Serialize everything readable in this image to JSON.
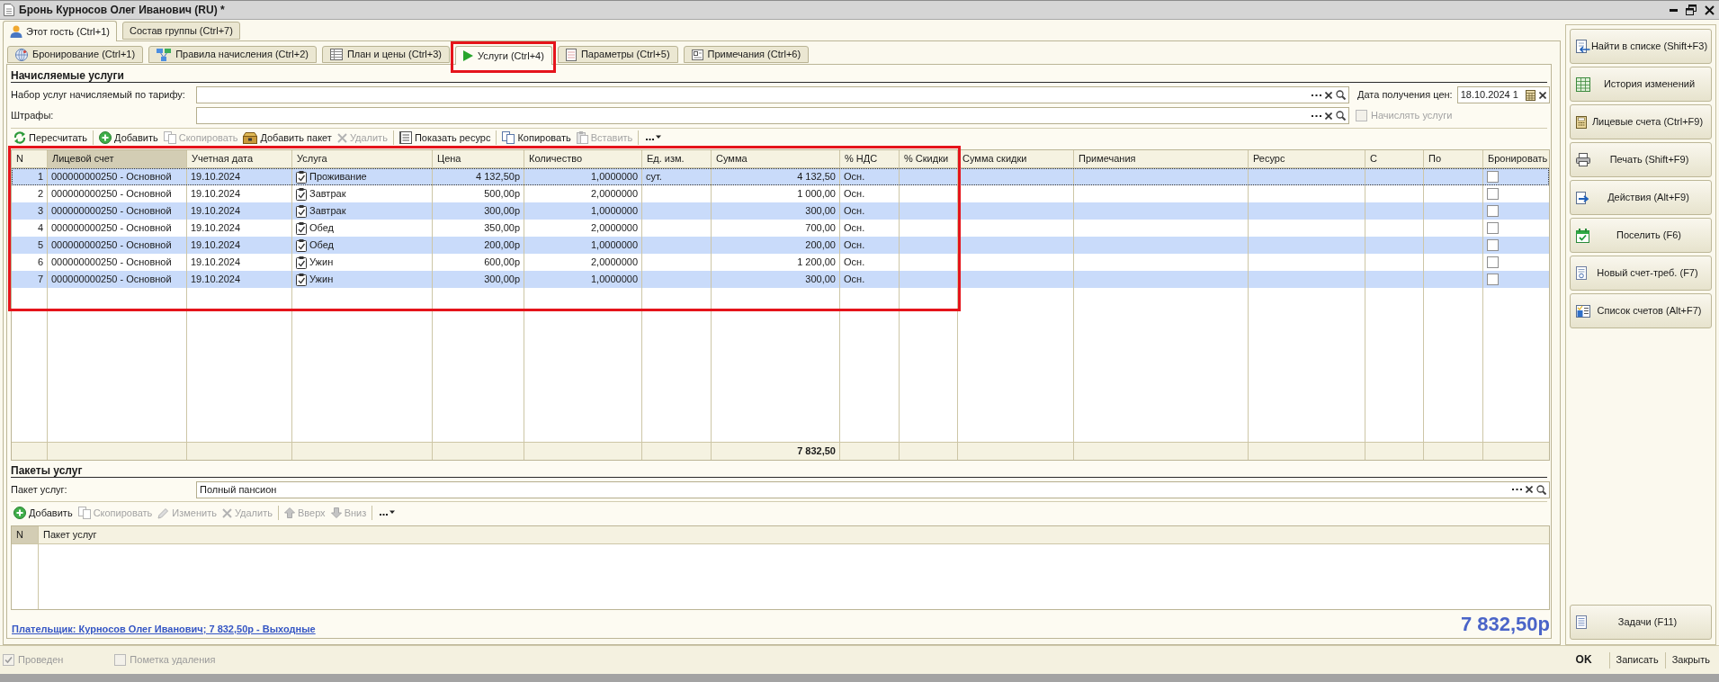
{
  "window": {
    "title": "Бронь Курносов Олег Иванович (RU) *"
  },
  "guest_tabs": [
    {
      "label": "Этот гость (Ctrl+1)",
      "selected": true
    },
    {
      "label": "Состав группы (Ctrl+7)",
      "selected": false
    }
  ],
  "section_tabs": [
    {
      "label": "Бронирование (Ctrl+1)",
      "selected": false,
      "highlighted": false
    },
    {
      "label": "Правила начисления (Ctrl+2)",
      "selected": false,
      "highlighted": false
    },
    {
      "label": "План и цены (Ctrl+3)",
      "selected": false,
      "highlighted": false
    },
    {
      "label": "Услуги (Ctrl+4)",
      "selected": true,
      "highlighted": true
    },
    {
      "label": "Параметры (Ctrl+5)",
      "selected": false,
      "highlighted": false
    },
    {
      "label": "Примечания (Ctrl+6)",
      "selected": false,
      "highlighted": false
    }
  ],
  "charged_services": {
    "title": "Начисляемые услуги",
    "tariff_set": {
      "label": "Набор услуг начисляемый по тарифу:"
    },
    "price_date": {
      "label": "Дата получения цен:",
      "value": "18.10.2024 1"
    },
    "penalties": {
      "label": "Штрафы:"
    },
    "charge_services": {
      "label": "Начислять услуги",
      "checked": false,
      "disabled": true
    },
    "toolbar": {
      "groups": [
        {
          "items": [
            {
              "label": "Пересчитать",
              "disabled": false
            }
          ]
        },
        {
          "items": [
            {
              "label": "Добавить",
              "disabled": false
            },
            {
              "label": "Скопировать",
              "disabled": true
            },
            {
              "label": "Добавить пакет",
              "disabled": false
            },
            {
              "label": "Удалить",
              "disabled": true
            }
          ]
        },
        {
          "items": [
            {
              "label": "Показать ресурс",
              "disabled": false
            }
          ]
        },
        {
          "items": [
            {
              "label": "Копировать",
              "disabled": false
            },
            {
              "label": "Вставить",
              "disabled": true
            }
          ]
        }
      ]
    },
    "table": {
      "highlighted": true,
      "columns": [
        {
          "label": "N",
          "current": false
        },
        {
          "label": "Лицевой счет",
          "current": true
        },
        {
          "label": "Учетная дата",
          "current": false
        },
        {
          "label": "Услуга",
          "current": false
        },
        {
          "label": "Цена",
          "current": false
        },
        {
          "label": "Количество",
          "current": false
        },
        {
          "label": "Ед. изм.",
          "current": false
        },
        {
          "label": "Сумма",
          "current": false
        },
        {
          "label": "% НДС",
          "current": false
        },
        {
          "label": "% Скидки",
          "current": false
        },
        {
          "label": "Сумма скидки",
          "current": false
        },
        {
          "label": "Примечания",
          "current": false
        },
        {
          "label": "Ресурс",
          "current": false
        },
        {
          "label": "С",
          "current": false
        },
        {
          "label": "По",
          "current": false
        },
        {
          "label": "Бронировать",
          "current": false
        }
      ],
      "rows": [
        {
          "n": "1",
          "account": "000000000250 - Основной",
          "date": "19.10.2024",
          "service": "Проживание",
          "price": "4 132,50р",
          "quantity": "1,0000000",
          "unit": "сут.",
          "sum": "4 132,50",
          "vat": "Осн.",
          "book": false,
          "current": true
        },
        {
          "n": "2",
          "account": "000000000250 - Основной",
          "date": "19.10.2024",
          "service": "Завтрак",
          "price": "500,00р",
          "quantity": "2,0000000",
          "sum": "1 000,00",
          "vat": "Осн.",
          "book": false,
          "current": false
        },
        {
          "n": "3",
          "account": "000000000250 - Основной",
          "date": "19.10.2024",
          "service": "Завтрак",
          "price": "300,00р",
          "quantity": "1,0000000",
          "sum": "300,00",
          "vat": "Осн.",
          "book": false,
          "current": false
        },
        {
          "n": "4",
          "account": "000000000250 - Основной",
          "date": "19.10.2024",
          "service": "Обед",
          "price": "350,00р",
          "quantity": "2,0000000",
          "sum": "700,00",
          "vat": "Осн.",
          "book": false,
          "current": false
        },
        {
          "n": "5",
          "account": "000000000250 - Основной",
          "date": "19.10.2024",
          "service": "Обед",
          "price": "200,00р",
          "quantity": "1,0000000",
          "sum": "200,00",
          "vat": "Осн.",
          "book": false,
          "current": false
        },
        {
          "n": "6",
          "account": "000000000250 - Основной",
          "date": "19.10.2024",
          "service": "Ужин",
          "price": "600,00р",
          "quantity": "2,0000000",
          "sum": "1 200,00",
          "vat": "Осн.",
          "book": false,
          "current": false
        },
        {
          "n": "7",
          "account": "000000000250 - Основной",
          "date": "19.10.2024",
          "service": "Ужин",
          "price": "300,00р",
          "quantity": "1,0000000",
          "sum": "300,00",
          "vat": "Осн.",
          "book": false,
          "current": false
        }
      ],
      "total_sum": "7 832,50"
    }
  },
  "service_packages": {
    "title": "Пакеты услуг",
    "package": {
      "label": "Пакет услуг:",
      "value": "Полный пансион"
    },
    "toolbar": {
      "groups": [
        {
          "items": [
            {
              "label": "Добавить",
              "disabled": false
            },
            {
              "label": "Скопировать",
              "disabled": true
            },
            {
              "label": "Изменить",
              "disabled": true
            },
            {
              "label": "Удалить",
              "disabled": true
            }
          ]
        },
        {
          "items": [
            {
              "label": "Вверх",
              "disabled": true
            },
            {
              "label": "Вниз",
              "disabled": true
            }
          ]
        }
      ]
    },
    "table": {
      "columns": [
        {
          "label": "N",
          "current": true
        },
        {
          "label": "Пакет услуг",
          "current": false
        }
      ]
    }
  },
  "payer_link": "Плательщик: Курносов Олег Иванович; 7 832,50р - Выходные",
  "total": "7 832,50р",
  "side_actions": [
    {
      "label": "Найти в списке (Shift+F3)"
    },
    {
      "label": "История изменений"
    },
    {
      "label": "Лицевые счета (Ctrl+F9)"
    },
    {
      "label": "Печать (Shift+F9)"
    },
    {
      "label": "Действия (Alt+F9)"
    },
    {
      "label": "Поселить (F6)"
    },
    {
      "label": "Новый счет-треб. (F7)"
    },
    {
      "label": "Список счетов (Alt+F7)"
    }
  ],
  "side_bottom_actions": [
    {
      "label": "Задачи (F11)"
    }
  ],
  "footer": {
    "checkboxes": [
      {
        "label": "Проведен",
        "checked": true,
        "disabled": true
      },
      {
        "label": "Пометка удаления",
        "checked": false,
        "disabled": true
      }
    ],
    "buttons": [
      {
        "label": "OK",
        "default": true
      },
      {
        "label": "Записать",
        "default": false
      },
      {
        "label": "Закрыть",
        "default": false
      }
    ]
  }
}
